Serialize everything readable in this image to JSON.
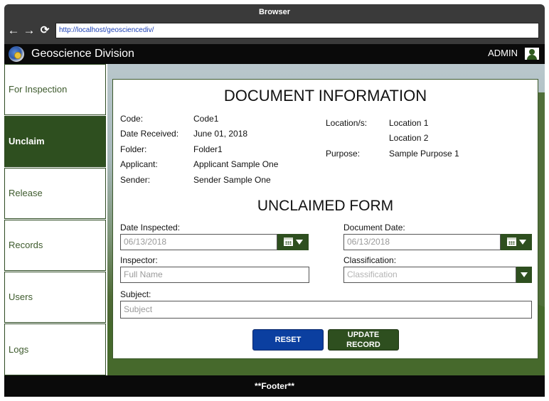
{
  "browser": {
    "title": "Browser",
    "url": "http://localhost/geosciencediv/",
    "back_symbol": "←",
    "forward_symbol": "→",
    "reload_symbol": "⟳"
  },
  "header": {
    "app_title": "Geoscience Division",
    "user_label": "ADMIN",
    "logo_icon": "seal-logo",
    "user_icon": "user-icon"
  },
  "sidebar": {
    "items": [
      {
        "label": "For Inspection"
      },
      {
        "label": "Unclaim",
        "active": true
      },
      {
        "label": "Release"
      },
      {
        "label": "Records"
      },
      {
        "label": "Users"
      },
      {
        "label": "Logs"
      }
    ]
  },
  "document_info": {
    "title": "DOCUMENT INFORMATION",
    "fields": [
      {
        "label": "Code:",
        "value": "Code1"
      },
      {
        "label": "Date Received:",
        "value": "June 01, 2018"
      },
      {
        "label": "Folder:",
        "value": "Folder1"
      },
      {
        "label": "Applicant:",
        "value": "Applicant Sample One"
      },
      {
        "label": "Sender:",
        "value": "Sender Sample One"
      }
    ],
    "locations_label": "Location/s:",
    "locations": [
      "Location 1",
      "Location 2"
    ],
    "purpose_label": "Purpose:",
    "purpose": "Sample Purpose 1"
  },
  "unclaimed_form": {
    "title": "UNCLAIMED FORM",
    "date_inspected": {
      "label": "Date Inspected:",
      "placeholder": "06/13/2018"
    },
    "document_date": {
      "label": "Document Date:",
      "placeholder": "06/13/2018"
    },
    "inspector": {
      "label": "Inspector:",
      "placeholder": "Full Name"
    },
    "classification": {
      "label": "Classification:",
      "placeholder": "Classification"
    },
    "subject": {
      "label": "Subject:",
      "placeholder": "Subject"
    },
    "reset_label": "RESET",
    "update_label": "UPDATE RECORD"
  },
  "footer": {
    "text": "**Footer**"
  },
  "colors": {
    "accent_green": "#2e4f1f",
    "reset_blue": "#0b3fa0",
    "header_black": "#0a0a0a"
  }
}
